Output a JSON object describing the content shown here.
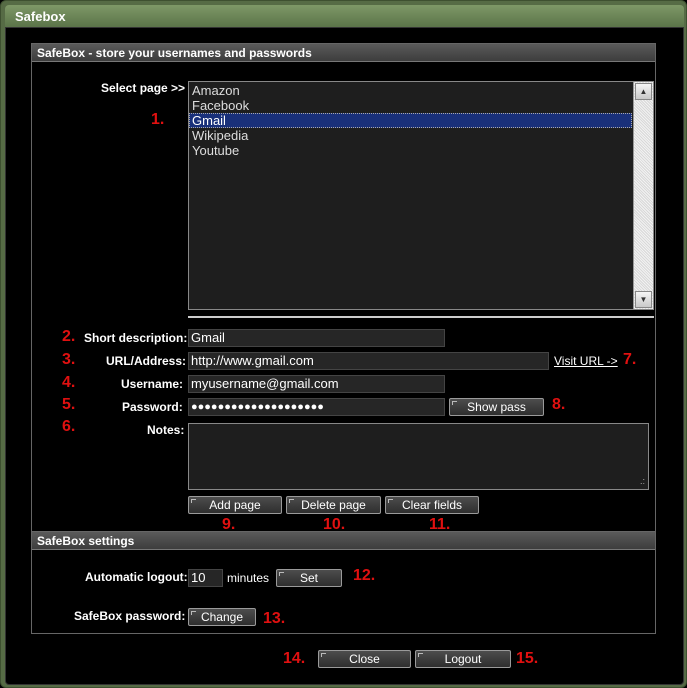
{
  "window": {
    "title": "Safebox"
  },
  "main_panel": {
    "header": "SafeBox - store your usernames and passwords",
    "select_page_label": "Select page >>",
    "pages": [
      "Amazon",
      "Facebook",
      "Gmail",
      "Wikipedia",
      "Youtube"
    ],
    "selected_page": "Gmail",
    "short_description": {
      "label": "Short description:",
      "value": "Gmail"
    },
    "url": {
      "label": "URL/Address:",
      "value": "http://www.gmail.com",
      "visit_link": "Visit URL ->"
    },
    "username": {
      "label": "Username:",
      "value": "myusername@gmail.com"
    },
    "password": {
      "label": "Password:",
      "value": "●●●●●●●●●●●●●●●●●●●●",
      "show_button": "Show pass"
    },
    "notes": {
      "label": "Notes:",
      "value": ""
    },
    "buttons": {
      "add": "Add page",
      "delete": "Delete page",
      "clear": "Clear fields"
    }
  },
  "settings_panel": {
    "header": "SafeBox settings",
    "auto_logout": {
      "label": "Automatic logout:",
      "value": "10",
      "unit": "minutes",
      "set_button": "Set"
    },
    "safebox_password": {
      "label": "SafeBox password:",
      "change_button": "Change"
    }
  },
  "footer": {
    "close_button": "Close",
    "logout_button": "Logout"
  },
  "annotations": [
    "1.",
    "2.",
    "3.",
    "4.",
    "5.",
    "6.",
    "7.",
    "8.",
    "9.",
    "10.",
    "11.",
    "12.",
    "13.",
    "14.",
    "15."
  ],
  "colors": {
    "frame": "#566b45",
    "annotation": "#e01010",
    "selection": "#19307a"
  }
}
